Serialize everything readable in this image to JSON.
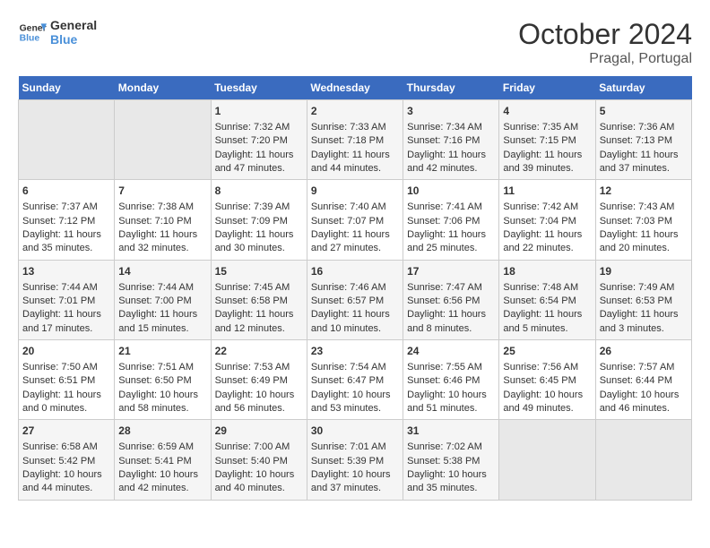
{
  "header": {
    "logo_line1": "General",
    "logo_line2": "Blue",
    "title": "October 2024",
    "subtitle": "Pragal, Portugal"
  },
  "weekdays": [
    "Sunday",
    "Monday",
    "Tuesday",
    "Wednesday",
    "Thursday",
    "Friday",
    "Saturday"
  ],
  "weeks": [
    [
      {
        "day": "",
        "content": ""
      },
      {
        "day": "",
        "content": ""
      },
      {
        "day": "1",
        "content": "Sunrise: 7:32 AM\nSunset: 7:20 PM\nDaylight: 11 hours and 47 minutes."
      },
      {
        "day": "2",
        "content": "Sunrise: 7:33 AM\nSunset: 7:18 PM\nDaylight: 11 hours and 44 minutes."
      },
      {
        "day": "3",
        "content": "Sunrise: 7:34 AM\nSunset: 7:16 PM\nDaylight: 11 hours and 42 minutes."
      },
      {
        "day": "4",
        "content": "Sunrise: 7:35 AM\nSunset: 7:15 PM\nDaylight: 11 hours and 39 minutes."
      },
      {
        "day": "5",
        "content": "Sunrise: 7:36 AM\nSunset: 7:13 PM\nDaylight: 11 hours and 37 minutes."
      }
    ],
    [
      {
        "day": "6",
        "content": "Sunrise: 7:37 AM\nSunset: 7:12 PM\nDaylight: 11 hours and 35 minutes."
      },
      {
        "day": "7",
        "content": "Sunrise: 7:38 AM\nSunset: 7:10 PM\nDaylight: 11 hours and 32 minutes."
      },
      {
        "day": "8",
        "content": "Sunrise: 7:39 AM\nSunset: 7:09 PM\nDaylight: 11 hours and 30 minutes."
      },
      {
        "day": "9",
        "content": "Sunrise: 7:40 AM\nSunset: 7:07 PM\nDaylight: 11 hours and 27 minutes."
      },
      {
        "day": "10",
        "content": "Sunrise: 7:41 AM\nSunset: 7:06 PM\nDaylight: 11 hours and 25 minutes."
      },
      {
        "day": "11",
        "content": "Sunrise: 7:42 AM\nSunset: 7:04 PM\nDaylight: 11 hours and 22 minutes."
      },
      {
        "day": "12",
        "content": "Sunrise: 7:43 AM\nSunset: 7:03 PM\nDaylight: 11 hours and 20 minutes."
      }
    ],
    [
      {
        "day": "13",
        "content": "Sunrise: 7:44 AM\nSunset: 7:01 PM\nDaylight: 11 hours and 17 minutes."
      },
      {
        "day": "14",
        "content": "Sunrise: 7:44 AM\nSunset: 7:00 PM\nDaylight: 11 hours and 15 minutes."
      },
      {
        "day": "15",
        "content": "Sunrise: 7:45 AM\nSunset: 6:58 PM\nDaylight: 11 hours and 12 minutes."
      },
      {
        "day": "16",
        "content": "Sunrise: 7:46 AM\nSunset: 6:57 PM\nDaylight: 11 hours and 10 minutes."
      },
      {
        "day": "17",
        "content": "Sunrise: 7:47 AM\nSunset: 6:56 PM\nDaylight: 11 hours and 8 minutes."
      },
      {
        "day": "18",
        "content": "Sunrise: 7:48 AM\nSunset: 6:54 PM\nDaylight: 11 hours and 5 minutes."
      },
      {
        "day": "19",
        "content": "Sunrise: 7:49 AM\nSunset: 6:53 PM\nDaylight: 11 hours and 3 minutes."
      }
    ],
    [
      {
        "day": "20",
        "content": "Sunrise: 7:50 AM\nSunset: 6:51 PM\nDaylight: 11 hours and 0 minutes."
      },
      {
        "day": "21",
        "content": "Sunrise: 7:51 AM\nSunset: 6:50 PM\nDaylight: 10 hours and 58 minutes."
      },
      {
        "day": "22",
        "content": "Sunrise: 7:53 AM\nSunset: 6:49 PM\nDaylight: 10 hours and 56 minutes."
      },
      {
        "day": "23",
        "content": "Sunrise: 7:54 AM\nSunset: 6:47 PM\nDaylight: 10 hours and 53 minutes."
      },
      {
        "day": "24",
        "content": "Sunrise: 7:55 AM\nSunset: 6:46 PM\nDaylight: 10 hours and 51 minutes."
      },
      {
        "day": "25",
        "content": "Sunrise: 7:56 AM\nSunset: 6:45 PM\nDaylight: 10 hours and 49 minutes."
      },
      {
        "day": "26",
        "content": "Sunrise: 7:57 AM\nSunset: 6:44 PM\nDaylight: 10 hours and 46 minutes."
      }
    ],
    [
      {
        "day": "27",
        "content": "Sunrise: 6:58 AM\nSunset: 5:42 PM\nDaylight: 10 hours and 44 minutes."
      },
      {
        "day": "28",
        "content": "Sunrise: 6:59 AM\nSunset: 5:41 PM\nDaylight: 10 hours and 42 minutes."
      },
      {
        "day": "29",
        "content": "Sunrise: 7:00 AM\nSunset: 5:40 PM\nDaylight: 10 hours and 40 minutes."
      },
      {
        "day": "30",
        "content": "Sunrise: 7:01 AM\nSunset: 5:39 PM\nDaylight: 10 hours and 37 minutes."
      },
      {
        "day": "31",
        "content": "Sunrise: 7:02 AM\nSunset: 5:38 PM\nDaylight: 10 hours and 35 minutes."
      },
      {
        "day": "",
        "content": ""
      },
      {
        "day": "",
        "content": ""
      }
    ]
  ]
}
